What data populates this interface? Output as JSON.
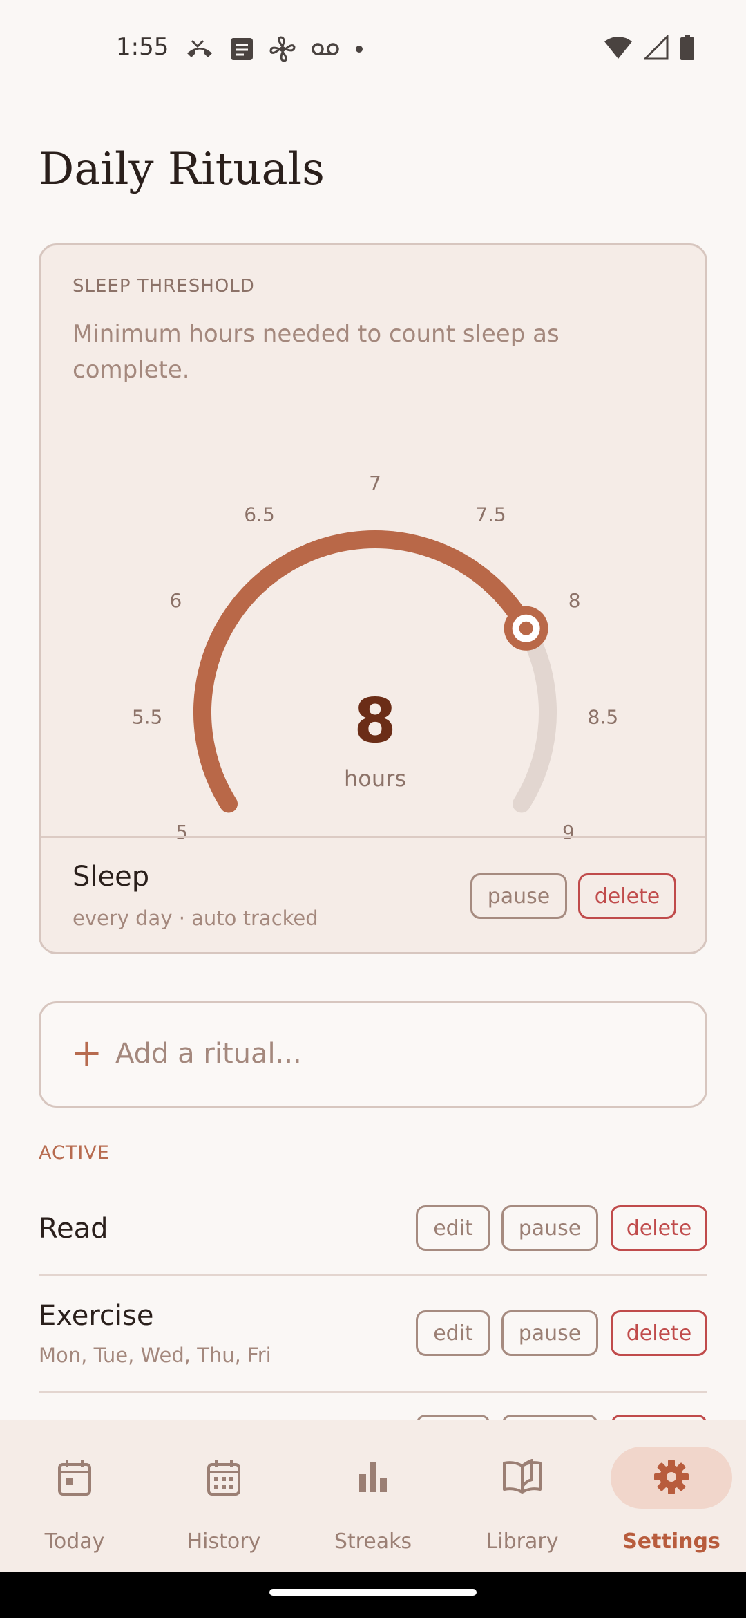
{
  "status_bar": {
    "time": "1:55",
    "left_icons": [
      "missed-call-icon",
      "notes-icon",
      "fan-icon",
      "voicemail-icon",
      "dot-icon"
    ],
    "right_icons": [
      "wifi-icon",
      "signal-icon",
      "battery-icon"
    ]
  },
  "page": {
    "title": "Daily Rituals"
  },
  "threshold_card": {
    "label": "SLEEP THRESHOLD",
    "description": "Minimum hours needed to count sleep as complete.",
    "gauge": {
      "min": 5,
      "max": 9,
      "value": 8,
      "ticks": [
        "5",
        "5.5",
        "6",
        "6.5",
        "7",
        "7.5",
        "8",
        "8.5",
        "9"
      ],
      "value_label": "8",
      "unit": "hours",
      "fill_color": "#b96848",
      "track_color": "#e2d6d0"
    },
    "ritual": {
      "name": "Sleep",
      "subtitle": "every day · auto tracked",
      "pause_label": "pause",
      "delete_label": "delete"
    }
  },
  "add_ritual": {
    "plus": "+",
    "placeholder": "Add a ritual..."
  },
  "active_section": {
    "label": "ACTIVE",
    "rituals": [
      {
        "name": "Read",
        "subtitle": "",
        "edit_label": "edit",
        "pause_label": "pause",
        "delete_label": "delete"
      },
      {
        "name": "Exercise",
        "subtitle": "Mon, Tue, Wed, Thu, Fri",
        "edit_label": "edit",
        "pause_label": "pause",
        "delete_label": "delete"
      }
    ]
  },
  "bottom_nav": {
    "items": [
      {
        "label": "Today",
        "icon": "calendar-today-icon",
        "active": false
      },
      {
        "label": "History",
        "icon": "calendar-grid-icon",
        "active": false
      },
      {
        "label": "Streaks",
        "icon": "bar-chart-icon",
        "active": false
      },
      {
        "label": "Library",
        "icon": "book-icon",
        "active": false
      },
      {
        "label": "Settings",
        "icon": "gear-icon",
        "active": true
      }
    ]
  },
  "colors": {
    "accent": "#b85c3d",
    "danger": "#c04b4b",
    "background": "#faf7f5",
    "card": "#f5ece7"
  }
}
